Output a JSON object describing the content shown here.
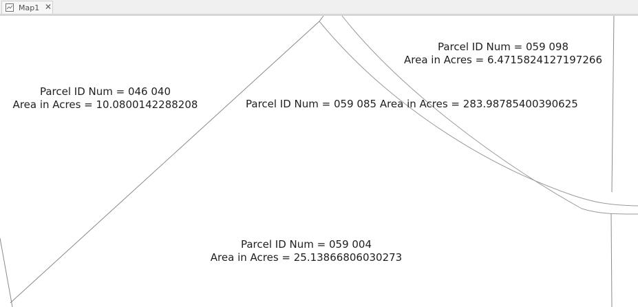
{
  "tab": {
    "title": "Map1",
    "close_glyph": "✕",
    "icon": "map-icon"
  },
  "parcels": [
    {
      "id_text": "Parcel ID Num = 046 040",
      "area_text": "Area in Acres = 10.0800142288208"
    },
    {
      "id_text": "Parcel ID Num = 059 098",
      "area_text": "Area in Acres = 6.4715824127197266"
    },
    {
      "id_text": "Parcel ID Num = 059 085",
      "area_text": "Area in Acres = 283.98785400390625"
    },
    {
      "id_text": "Parcel ID Num = 059 004",
      "area_text": "Area in Acres = 25.13866806030273"
    }
  ],
  "colors": {
    "boundary_line": "#8a8a8a",
    "road_line": "#9a9a9a",
    "label_text": "#1e1e1e"
  }
}
